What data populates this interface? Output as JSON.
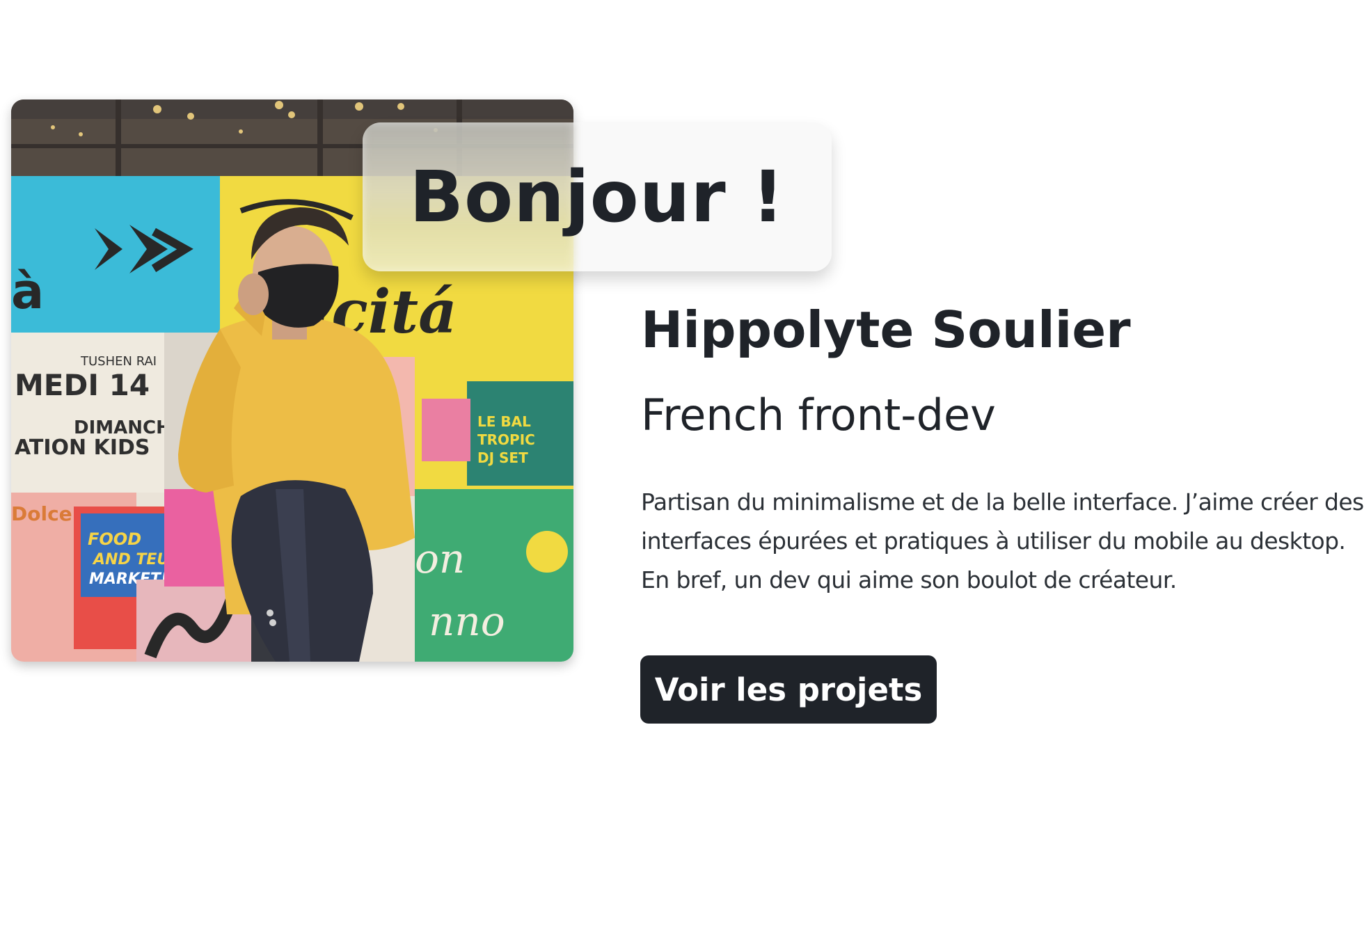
{
  "hero": {
    "greeting": "Bonjour !",
    "name": "Hippolyte Soulier",
    "role": "French front-dev",
    "bio": "Partisan du minimalisme et de la belle interface. J’aime créer des interfaces épurées et pratiques à utiliser du mobile au desktop. En bref, un dev qui aime son boulot de créateur.",
    "cta_label": "Voir les projets"
  },
  "photo": {
    "alt": "Portrait photo"
  },
  "colors": {
    "text_dark": "#1f2329",
    "button_bg": "#1f2329",
    "button_text": "#ffffff",
    "page_bg": "#ffffff"
  }
}
